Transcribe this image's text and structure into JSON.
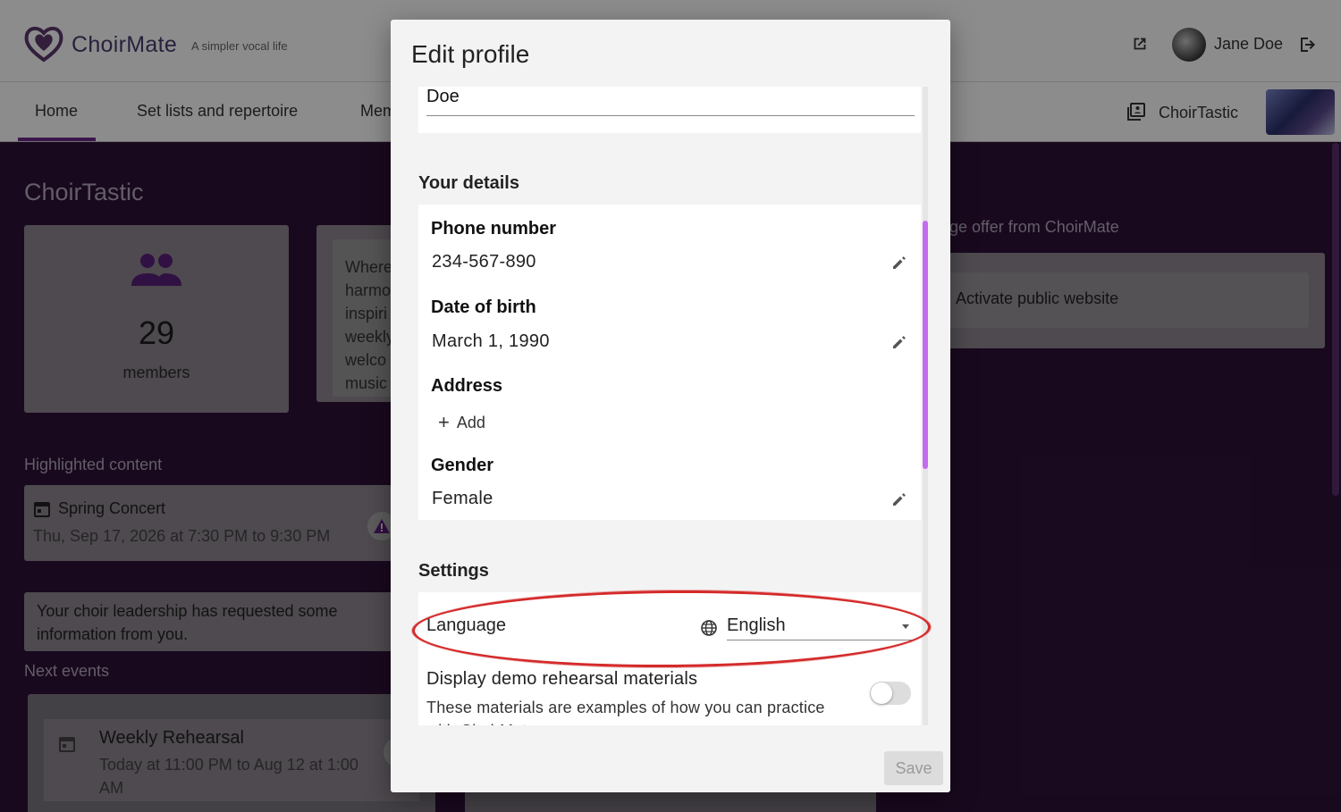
{
  "header": {
    "brand": "ChoirMate",
    "tagline": "A simpler vocal life",
    "user_name": "Jane Doe"
  },
  "nav": {
    "items": [
      "Home",
      "Set lists and repertoire",
      "Mem"
    ],
    "active": "Home",
    "choir_name": "ChoirTastic"
  },
  "dashboard": {
    "title": "ChoirTastic",
    "members_count": "29",
    "members_label": "members",
    "about_lines": [
      "Where",
      "harmo",
      "inspiri",
      "weekly",
      "welco",
      "music"
    ],
    "highlighted_label": "Highlighted content",
    "highlight_event": {
      "title": "Spring Concert",
      "time": "Thu, Sep 17, 2026 at 7:30 PM to 9:30 PM"
    },
    "request_text": "Your choir leadership has requested some information from you.",
    "next_events_label": "Next events",
    "next_event": {
      "title": "Weekly Rehearsal",
      "time": "Today at 11:00 PM to Aug 12 at 1:00 AM"
    },
    "offer_title": "ge offer from ChoirMate",
    "offer_action": "Activate public website"
  },
  "modal": {
    "title": "Edit profile",
    "last_name": "Doe",
    "details_section": "Your details",
    "fields": {
      "phone_label": "Phone number",
      "phone_value": "234-567-890",
      "dob_label": "Date of birth",
      "dob_value": "March 1, 1990",
      "address_label": "Address",
      "address_add": "Add",
      "gender_label": "Gender",
      "gender_value": "Female"
    },
    "settings_section": "Settings",
    "language_label": "Language",
    "language_value": "English",
    "demo_label": "Display demo rehearsal materials",
    "demo_desc": "These materials are examples of how you can practice with ChoirMate",
    "demo_enabled": false,
    "save_label": "Save"
  },
  "colors": {
    "brand_purple": "#6d2a8a",
    "scroll_accent": "#c56cf0",
    "highlight_ring": "#d42a2a"
  }
}
